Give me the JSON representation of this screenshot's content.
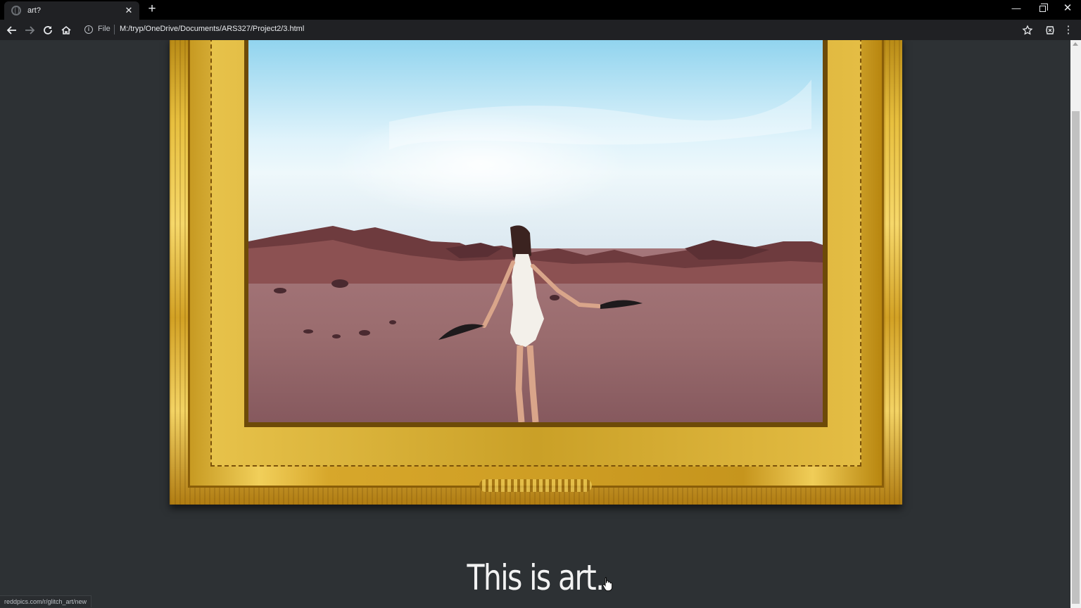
{
  "tab": {
    "title": "art?",
    "favicon": "globe-icon",
    "close": "✕"
  },
  "new_tab_label": "+",
  "window_controls": {
    "minimize": "—",
    "close": "✕"
  },
  "toolbar": {
    "back": "back-arrow-icon",
    "forward": "forward-arrow-icon",
    "reload": "reload-icon",
    "home": "home-icon",
    "info_glyph": "i",
    "origin": "File",
    "url": "M:/tryp/OneDrive/Documents/ARS327/Project2/3.html",
    "bookmark": "star-icon",
    "extension": "extension-icon",
    "menu": "⋮"
  },
  "page": {
    "caption": "This is art.",
    "painting": "Woman in white dress holding feathers in desert landscape, inside ornate gold frame"
  },
  "status_url": "reddpics.com/r/glitch_art/new",
  "colors": {
    "page_bg": "#2d3134",
    "chrome_bg": "#202124",
    "frame_gold": "#e7bf3e"
  }
}
